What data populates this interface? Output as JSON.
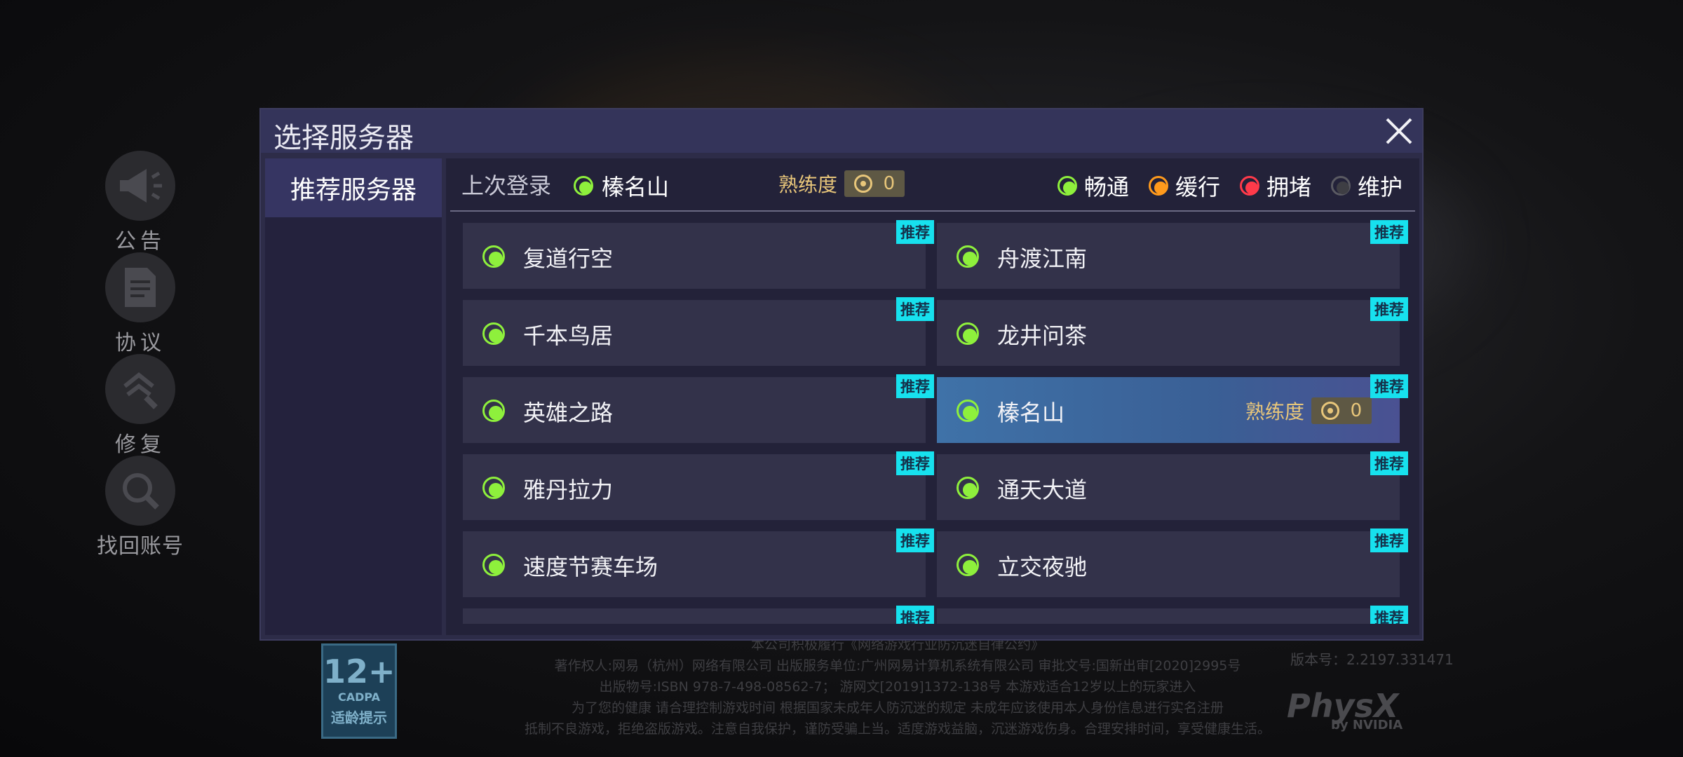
{
  "side_menu": [
    {
      "label": "公告",
      "icon": "megaphone-icon"
    },
    {
      "label": "协议",
      "icon": "document-icon"
    },
    {
      "label": "修复",
      "icon": "wrench-icon"
    },
    {
      "label": "找回账号",
      "icon": "account-search-icon"
    }
  ],
  "dialog": {
    "title": "选择服务器",
    "close_icon": "close-icon",
    "tabs": [
      {
        "label": "推荐服务器",
        "active": true
      }
    ]
  },
  "info": {
    "last_login_label": "上次登录",
    "last_server": "榛名山",
    "proficiency_label": "熟练度",
    "proficiency_value": "0"
  },
  "legend": [
    {
      "label": "畅通",
      "status": "green"
    },
    {
      "label": "缓行",
      "status": "orange"
    },
    {
      "label": "拥堵",
      "status": "red"
    },
    {
      "label": "维护",
      "status": "gray"
    }
  ],
  "servers": [
    {
      "name": "复道行空",
      "badge": "推荐"
    },
    {
      "name": "舟渡江南",
      "badge": "推荐"
    },
    {
      "name": "千本鸟居",
      "badge": "推荐"
    },
    {
      "name": "龙井问茶",
      "badge": "推荐"
    },
    {
      "name": "英雄之路",
      "badge": "推荐"
    },
    {
      "name": "榛名山",
      "badge": "推荐",
      "selected": true,
      "proficiency_label": "熟练度",
      "proficiency_value": "0"
    },
    {
      "name": "雅丹拉力",
      "badge": "推荐"
    },
    {
      "name": "通天大道",
      "badge": "推荐"
    },
    {
      "name": "速度节赛车场",
      "badge": "推荐"
    },
    {
      "name": "立交夜驰",
      "badge": "推荐"
    },
    {
      "name": "",
      "badge": "推荐"
    },
    {
      "name": "",
      "badge": "推荐"
    }
  ],
  "colors": {
    "status_green": "#8ef03c",
    "status_orange": "#ff9a1c",
    "status_red": "#ff3a4a",
    "status_gray": "#3e3e44",
    "badge_bg": "#17e1ee",
    "selected_bg": "#3f72a8"
  },
  "footer": {
    "line1": "本公司积极履行《网络游戏行业防沉迷自律公约》",
    "line2": "著作权人:网易（杭州）网络有限公司  出版服务单位:广州网易计算机系统有限公司  审批文号:国新出审[2020]2995号",
    "line3": "出版物号:ISBN 978-7-498-08562-7；  游网文[2019]1372-138号  本游戏适合12岁以上的玩家进入",
    "line4": "为了您的健康 请合理控制游戏时间 根据国家未成年人防沉迷的规定 未成年应该使用本人身份信息进行实名注册",
    "line5": "抵制不良游戏，拒绝盗版游戏。注意自我保护，谨防受骗上当。适度游戏益脑，沉迷游戏伤身。合理安排时间，享受健康生活。"
  },
  "age_badge": {
    "age": "12+",
    "org": "CADPA",
    "label": "适龄提示"
  },
  "version": "版本号：2.2197.331471",
  "physx": {
    "brand": "PhysX",
    "sub": "by NVIDIA"
  }
}
